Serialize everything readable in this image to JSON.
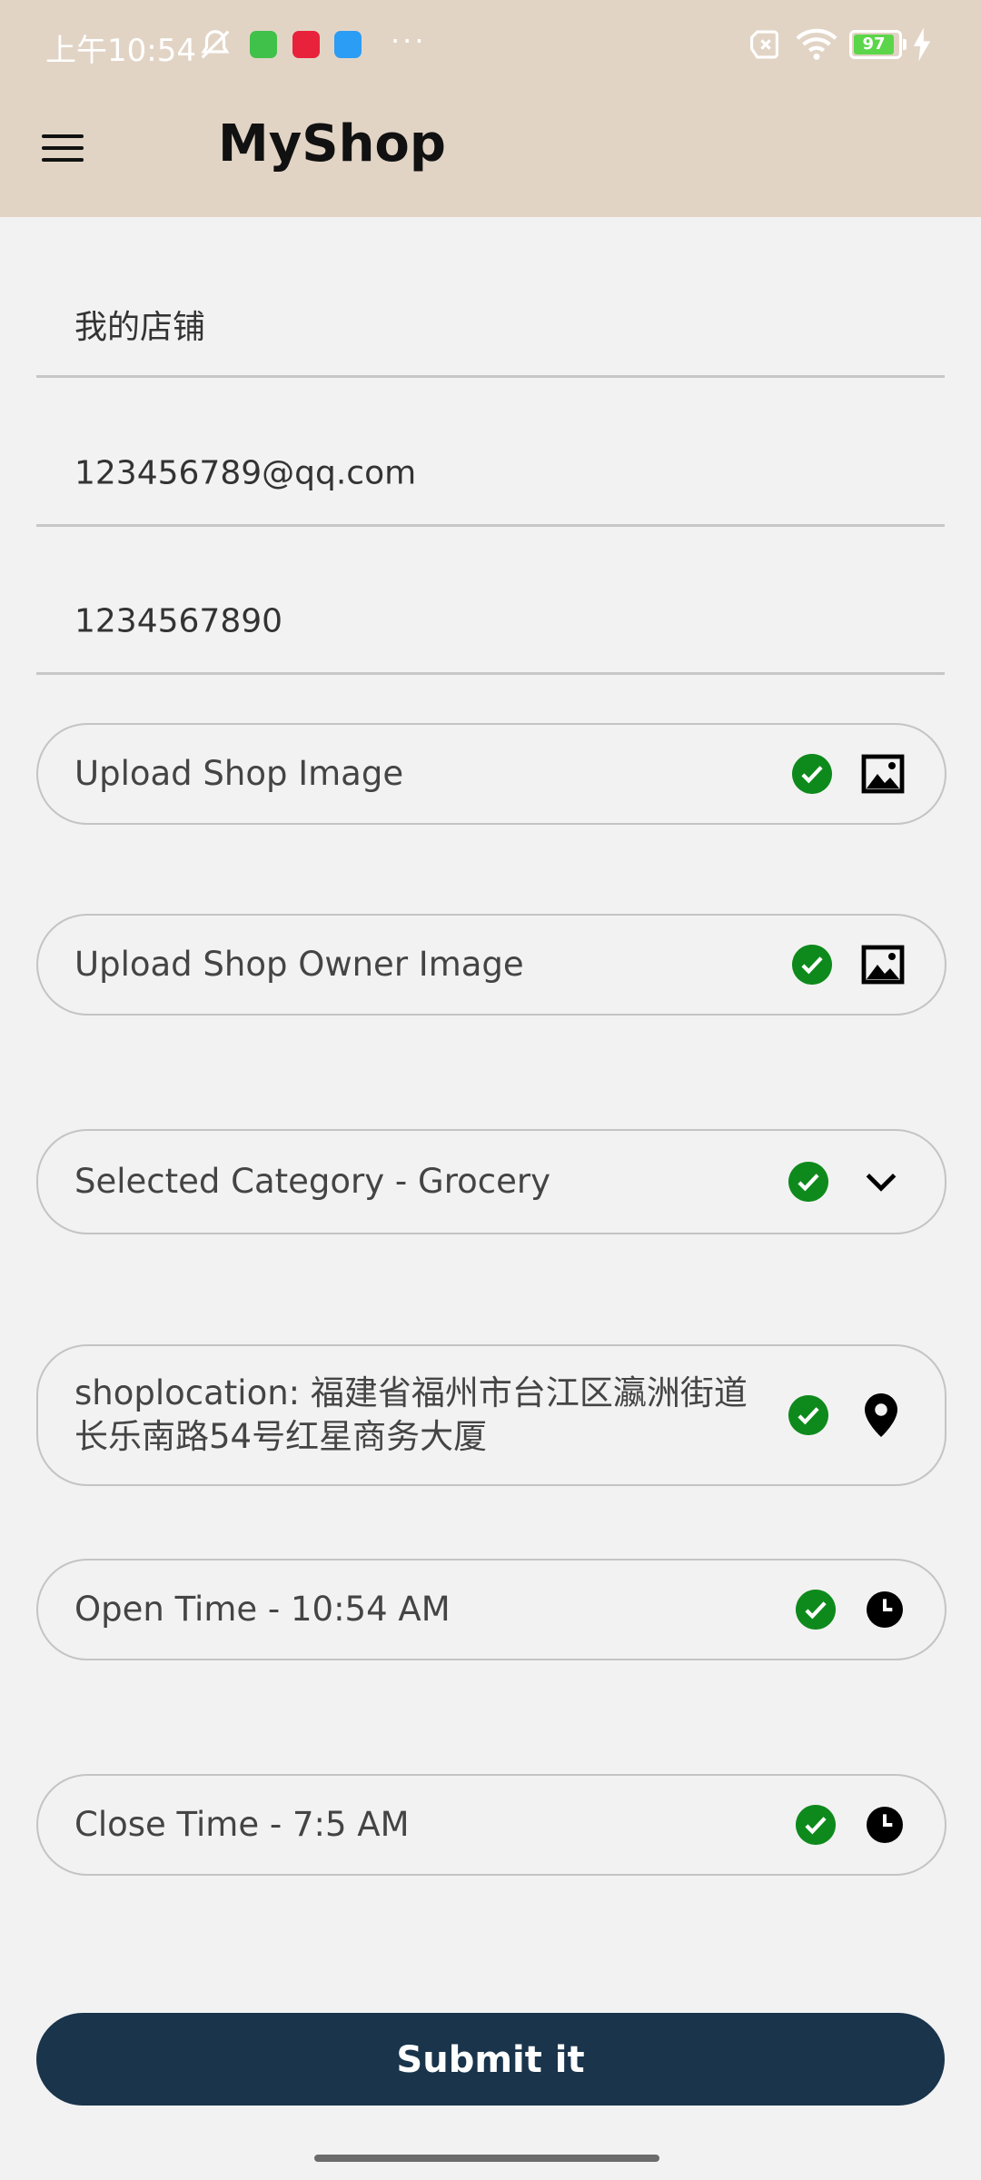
{
  "status_bar": {
    "time": "上午10:54",
    "more": "···",
    "battery": "97"
  },
  "header": {
    "title": "MyShop"
  },
  "fields": {
    "shop_name": "我的店铺",
    "email": "123456789@qq.com",
    "phone": "1234567890"
  },
  "uploads": {
    "shop_image": "Upload Shop Image",
    "owner_image": "Upload Shop Owner Image"
  },
  "category": {
    "label": "Selected Category - Grocery"
  },
  "location": {
    "line1": "shoplocation: 福建省福州市台江区瀛洲街道",
    "line2": "长乐南路54号红星商务大厦"
  },
  "times": {
    "open": "Open Time - 10:54 AM",
    "close": "Close Time - 7:5 AM"
  },
  "actions": {
    "submit": "Submit it"
  },
  "colors": {
    "header_bg": "#e2d4c5",
    "check_green": "#0e8a1c",
    "submit_bg": "#19344b",
    "page_bg": "#f2f2f2"
  }
}
